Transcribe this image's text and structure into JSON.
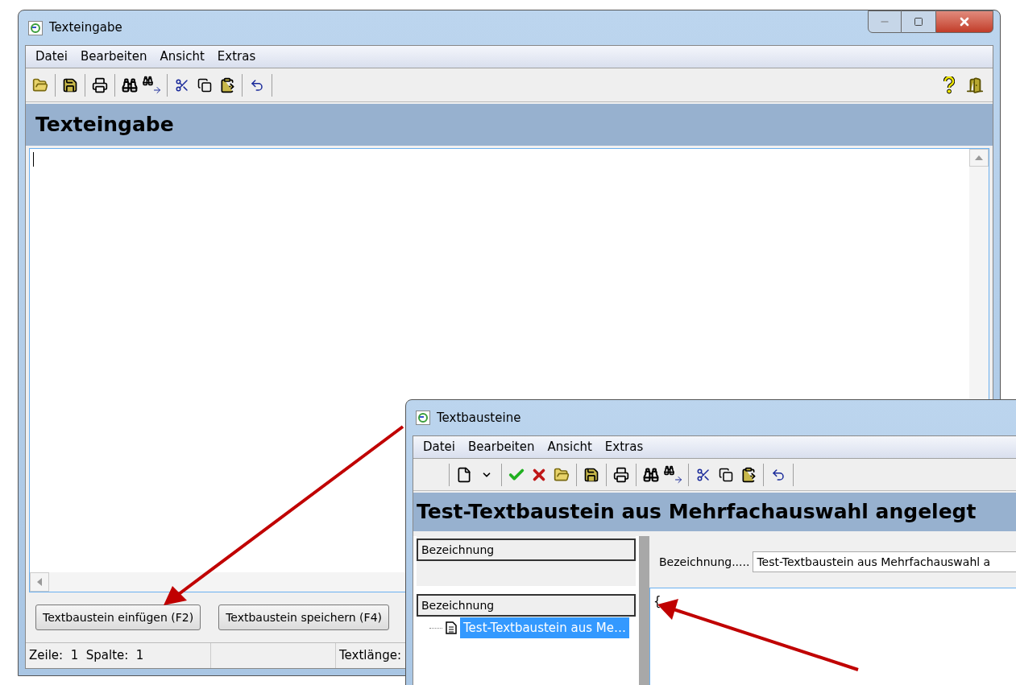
{
  "main_window": {
    "title": "Texteingabe",
    "menu": [
      "Datei",
      "Bearbeiten",
      "Ansicht",
      "Extras"
    ],
    "heading": "Texteingabe",
    "buttons": [
      "Textbaustein einfügen (F2)",
      "Textbaustein speichern (F4)"
    ],
    "status_bar": {
      "position": "Zeile:  1  Spalte:  1",
      "length": "Textlänge:"
    }
  },
  "second_window": {
    "title": "Textbausteine",
    "menu": [
      "Datei",
      "Bearbeiten",
      "Ansicht",
      "Extras"
    ],
    "heading": "Test-Textbaustein aus Mehrfachauswahl angelegt",
    "list_header": "Bezeichnung",
    "tree_header": "Bezeichnung",
    "tree": [
      {
        "label": "Test-Textbaustein aus Me…",
        "selected": true
      }
    ],
    "field_label": "Bezeichnung.....",
    "field_value": "Test-Textbaustein aus Mehrfachauswahl a",
    "editor_text": "{"
  }
}
